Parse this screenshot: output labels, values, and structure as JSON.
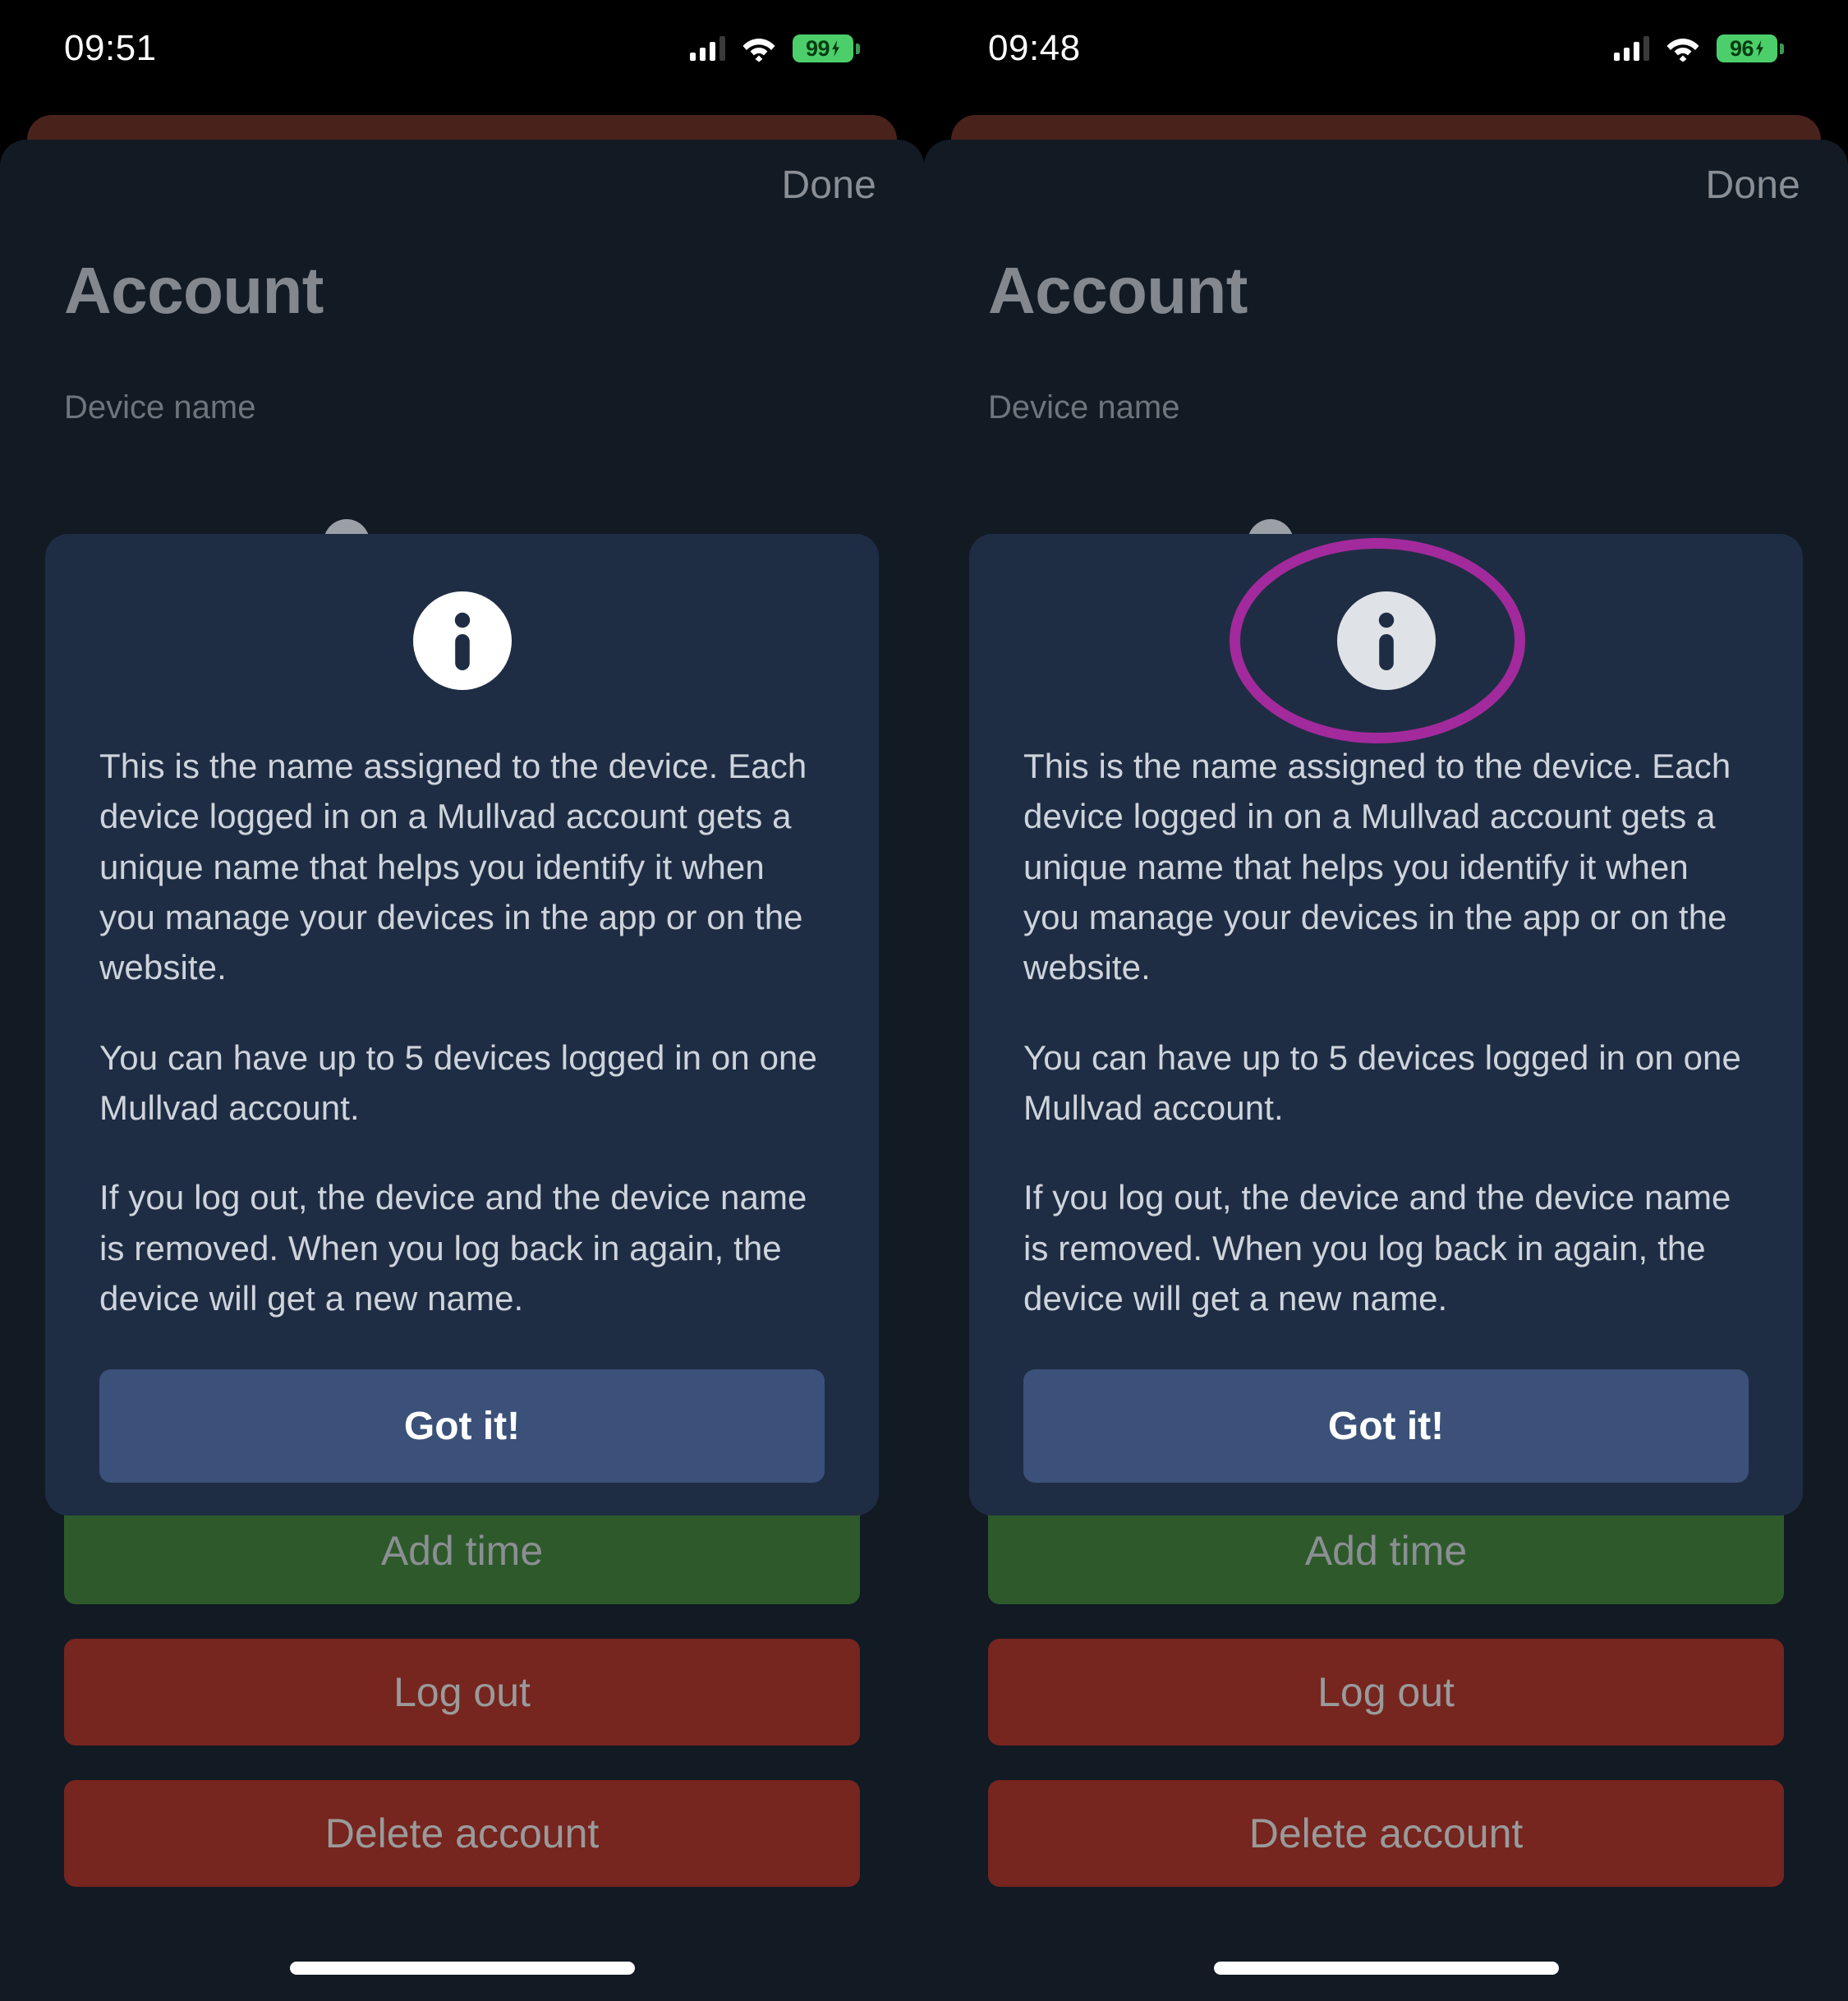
{
  "panels": [
    {
      "id": "left",
      "statusbar": {
        "time": "09:51",
        "battery_level": "99",
        "cellular_icon": "cellular-bars-icon",
        "wifi_icon": "wifi-icon",
        "battery_icon": "battery-charging-icon"
      },
      "sheet": {
        "done_label": "Done",
        "title": "Account",
        "field_label": "Device name"
      },
      "dialog": {
        "icon": "info-circle-icon",
        "paragraphs": [
          "This is the name assigned to the device. Each device logged in on a Mullvad account gets a unique name that helps you identify it when you manage your devices in the app or on the website.",
          "You can have up to 5 devices logged in on one Mullvad account.",
          "If you log out, the device and the device name is removed. When you log back in again, the device will get a new name."
        ],
        "confirm_label": "Got it!"
      },
      "actions": [
        {
          "label": "Add time",
          "style": "green"
        },
        {
          "label": "Log out",
          "style": "red"
        },
        {
          "label": "Delete account",
          "style": "red"
        }
      ],
      "annotation": null
    },
    {
      "id": "right",
      "statusbar": {
        "time": "09:48",
        "battery_level": "96",
        "cellular_icon": "cellular-bars-icon",
        "wifi_icon": "wifi-icon",
        "battery_icon": "battery-charging-icon"
      },
      "sheet": {
        "done_label": "Done",
        "title": "Account",
        "field_label": "Device name"
      },
      "dialog": {
        "icon": "info-circle-icon",
        "paragraphs": [
          "This is the name assigned to the device. Each device logged in on a Mullvad account gets a unique name that helps you identify it when you manage your devices in the app or on the website.",
          "You can have up to 5 devices logged in on one Mullvad account.",
          "If you log out, the device and the device name is removed. When you log back in again, the device will get a new name."
        ],
        "confirm_label": "Got it!"
      },
      "actions": [
        {
          "label": "Add time",
          "style": "green"
        },
        {
          "label": "Log out",
          "style": "red"
        },
        {
          "label": "Delete account",
          "style": "red"
        }
      ],
      "annotation": {
        "shape": "ellipse",
        "target": "info-circle-icon",
        "color": "#a32a9c"
      }
    }
  ],
  "colors": {
    "screen_background": "#000000",
    "sheet_background": "#121a24",
    "dialog_card": "#1f2d44",
    "red_underlay": "#4a221c",
    "primary_button": "#3b5179",
    "add_time_green": "#2e5a2b",
    "destructive_red": "#76251f",
    "battery_green": "#4ccf6b",
    "annotation_magenta": "#a32a9c",
    "title_text": "#83888e",
    "body_text": "#ced4dc"
  }
}
